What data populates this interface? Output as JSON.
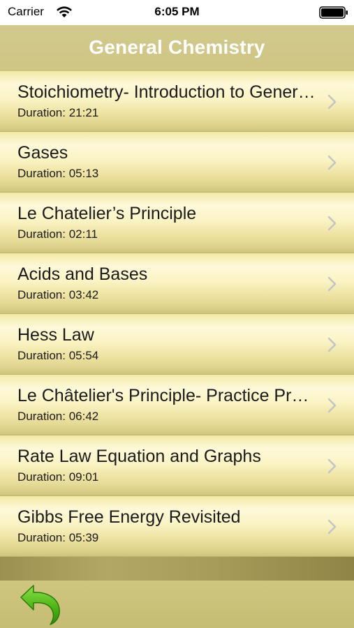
{
  "status_bar": {
    "carrier": "Carrier",
    "time": "6:05 PM"
  },
  "header": {
    "title": "General Chemistry"
  },
  "lessons": [
    {
      "title": "Stoichiometry- Introduction to General Chemistry",
      "duration": "Duration: 21:21"
    },
    {
      "title": "Gases",
      "duration": "Duration: 05:13"
    },
    {
      "title": "Le Chatelier’s Principle",
      "duration": "Duration: 02:11"
    },
    {
      "title": "Acids and Bases",
      "duration": "Duration: 03:42"
    },
    {
      "title": "Hess Law",
      "duration": "Duration: 05:54"
    },
    {
      "title": "Le Châtelier's Principle- Practice Problems",
      "duration": "Duration: 06:42"
    },
    {
      "title": "Rate Law Equation and Graphs",
      "duration": "Duration: 09:01"
    },
    {
      "title": "Gibbs Free Energy Revisited",
      "duration": "Duration: 05:39"
    }
  ],
  "icons": {
    "chevron": "chevron-right-icon",
    "back": "back-arrow-icon"
  },
  "colors": {
    "accent": "#c9c184",
    "back_arrow": "#5bbf1f"
  }
}
